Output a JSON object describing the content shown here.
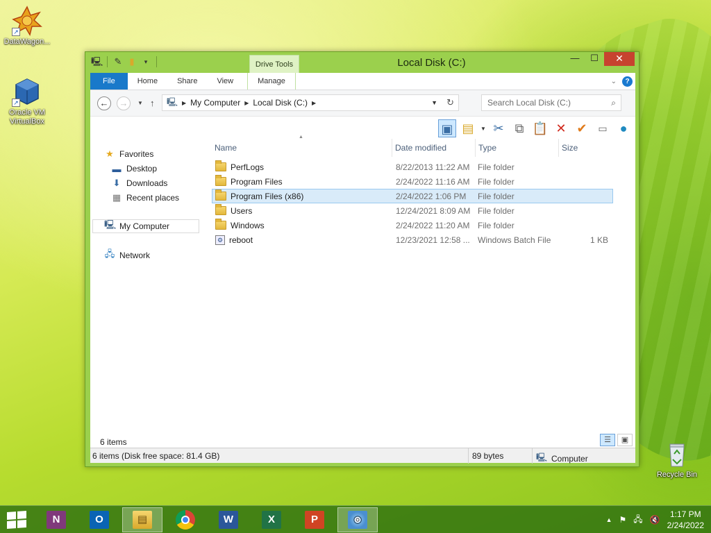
{
  "desktop": {
    "icons": [
      {
        "label": "DataWagon..."
      },
      {
        "label": "Oracle VM VirtualBox"
      },
      {
        "label": "Recycle Bin"
      }
    ]
  },
  "window": {
    "title": "Local Disk (C:)",
    "context_tab_group": "Drive Tools",
    "tabs": [
      "File",
      "Home",
      "Share",
      "View",
      "Manage"
    ],
    "address": {
      "segments": [
        "My Computer",
        "Local Disk (C:)"
      ]
    },
    "search": {
      "placeholder": "Search Local Disk (C:)"
    },
    "columns": [
      "Name",
      "Date modified",
      "Type",
      "Size"
    ],
    "nav": {
      "favorites": "Favorites",
      "desktop": "Desktop",
      "downloads": "Downloads",
      "recent": "Recent places",
      "computer": "My Computer",
      "network": "Network"
    },
    "files": [
      {
        "name": "PerfLogs",
        "date": "8/22/2013 11:22 AM",
        "type": "File folder",
        "size": "",
        "icon": "folder-icon"
      },
      {
        "name": "Program Files",
        "date": "2/24/2022 11:16 AM",
        "type": "File folder",
        "size": "",
        "icon": "folder-icon"
      },
      {
        "name": "Program Files (x86)",
        "date": "2/24/2022 1:06 PM",
        "type": "File folder",
        "size": "",
        "icon": "folder-icon",
        "selected": true
      },
      {
        "name": "Users",
        "date": "12/24/2021 8:09 AM",
        "type": "File folder",
        "size": "",
        "icon": "folder-icon"
      },
      {
        "name": "Windows",
        "date": "2/24/2022 11:20 AM",
        "type": "File folder",
        "size": "",
        "icon": "folder-icon"
      },
      {
        "name": "reboot",
        "date": "12/23/2021 12:58 ...",
        "type": "Windows Batch File",
        "size": "1 KB",
        "icon": "batch-file-icon"
      }
    ],
    "items_count": "6 items",
    "status": {
      "left": "6 items (Disk free space: 81.4 GB)",
      "middle": "89 bytes",
      "right": "Computer"
    }
  },
  "taskbar": {
    "apps": [
      "OneNote",
      "Outlook",
      "File Explorer",
      "Chrome",
      "Word",
      "Excel",
      "PowerPoint",
      "Disk Utility"
    ],
    "clock": {
      "time": "1:17 PM",
      "date": "2/24/2022"
    }
  },
  "colors": {
    "accent": "#1979ca",
    "window_frame": "#9bd04d",
    "selection": "#d9ebf9"
  }
}
